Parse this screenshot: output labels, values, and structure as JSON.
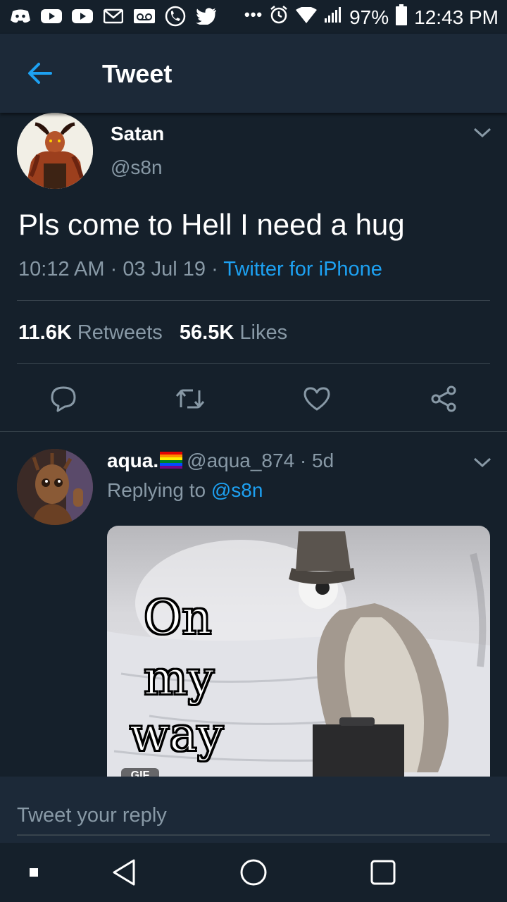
{
  "status_bar": {
    "battery": "97%",
    "time": "12:43 PM",
    "overflow": "•••",
    "icons": [
      "discord-icon",
      "youtube-icon",
      "youtube-icon",
      "gmail-icon",
      "voicemail-icon",
      "phone-icon",
      "twitter-icon",
      "alarm-icon",
      "wifi-icon",
      "signal-icon",
      "battery-icon"
    ]
  },
  "header": {
    "title": "Tweet",
    "back_icon": "arrow-left-icon"
  },
  "tweet": {
    "author_name": "Satan",
    "author_handle": "@s8n",
    "text": "Pls come to Hell I need a hug",
    "time": "10:12 AM",
    "date": "03 Jul 19",
    "source": "Twitter for iPhone",
    "retweets_count": "11.6K",
    "retweets_label": "Retweets",
    "likes_count": "56.5K",
    "likes_label": "Likes",
    "actions": [
      "reply-icon",
      "retweet-icon",
      "like-icon",
      "share-icon"
    ]
  },
  "reply": {
    "author_name": "aqua.",
    "author_handle": "@aqua_874",
    "age": "5d",
    "replying_label": "Replying to",
    "replying_to": "@s8n",
    "gif_caption": [
      "On",
      "my",
      "way"
    ],
    "gif_badge": "GIF"
  },
  "composer": {
    "placeholder": "Tweet your reply"
  },
  "colors": {
    "background": "#15202b",
    "bar": "#1c2938",
    "accent": "#1da1f2",
    "secondary_text": "#8899a6",
    "divider": "#38444d"
  }
}
